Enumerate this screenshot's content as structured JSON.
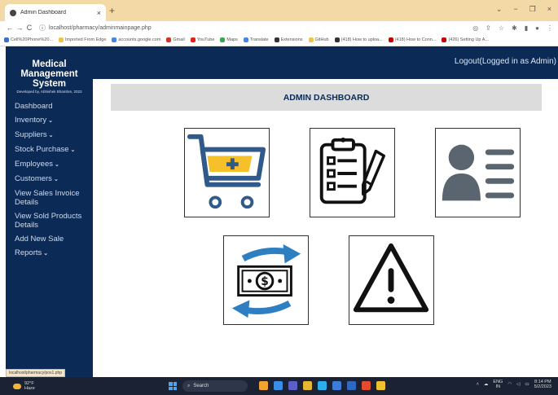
{
  "browser": {
    "tab_title": "Admin Dashboard",
    "tab_close": "×",
    "new_tab": "+",
    "window_controls": [
      "⌄",
      "−",
      "❐",
      "×"
    ],
    "nav": {
      "back": "←",
      "forward": "→",
      "reload": "C"
    },
    "url": "localhost/pharmacy/adminmainpage.php",
    "bookmarks": [
      {
        "label": "Cell%20Phone%20...",
        "color": "#3b6fd6"
      },
      {
        "label": "Imported From Edge",
        "color": "#f2c344"
      },
      {
        "label": "accounts.google.com",
        "color": "#4285f4"
      },
      {
        "label": "Gmail",
        "color": "#d93025"
      },
      {
        "label": "YouTube",
        "color": "#e62117"
      },
      {
        "label": "Maps",
        "color": "#34a853"
      },
      {
        "label": "Translate",
        "color": "#4285f4"
      },
      {
        "label": "Extensions",
        "color": "#333333"
      },
      {
        "label": "GitHub",
        "color": "#f2c344"
      },
      {
        "label": "(418) How to uploa...",
        "color": "#333333"
      },
      {
        "label": "(418) How to Conn...",
        "color": "#cc0000"
      },
      {
        "label": "(426) Setting Up A...",
        "color": "#cc0000"
      }
    ],
    "status_url": "localhost/pharmacy/pos1.php"
  },
  "sidebar": {
    "brand": [
      "Medical",
      "Management",
      "System"
    ],
    "developer": "Developed by, Abhishek Bhambre, 2023",
    "items": [
      {
        "label": "Dashboard",
        "caret": ""
      },
      {
        "label": "Inventory",
        "caret": "⌄"
      },
      {
        "label": "Suppliers",
        "caret": "⌄"
      },
      {
        "label": "Stock Purchase",
        "caret": "⌄"
      },
      {
        "label": "Employees",
        "caret": "⌄"
      },
      {
        "label": "Customers",
        "caret": "⌄"
      },
      {
        "label": "View Sales Invoice Details",
        "caret": ""
      },
      {
        "label": "View Sold Products Details",
        "caret": ""
      },
      {
        "label": "Add New Sale",
        "caret": ""
      },
      {
        "label": "Reports",
        "caret": "⌄"
      }
    ]
  },
  "header": {
    "logout": "Logout(Logged in as Admin)"
  },
  "main": {
    "title": "ADMIN DASHBOARD",
    "cards": [
      {
        "icon": "cart-add-icon"
      },
      {
        "icon": "clipboard-list-icon"
      },
      {
        "icon": "user-profile-icon"
      },
      {
        "icon": "money-exchange-icon"
      },
      {
        "icon": "warning-icon"
      }
    ]
  },
  "colors": {
    "navy": "#0b2a55",
    "cart_blue": "#2f5a8a",
    "cart_yellow": "#f5c02a",
    "exchange_blue": "#2e7fc2",
    "user_gray": "#5a6570"
  },
  "taskbar": {
    "weather_temp": "92°F",
    "weather_desc": "Haze",
    "search_placeholder": "Search",
    "lang": "ENG",
    "region": "IN",
    "time": "8:14 PM",
    "date": "5/2/2023",
    "apps": [
      "#f2a22f",
      "#3a8ee6",
      "#5b5fc7",
      "#e8b730",
      "#2bb0ed",
      "#3b7dd8",
      "#2f68c0",
      "#e24b2d",
      "#f0c030"
    ]
  }
}
